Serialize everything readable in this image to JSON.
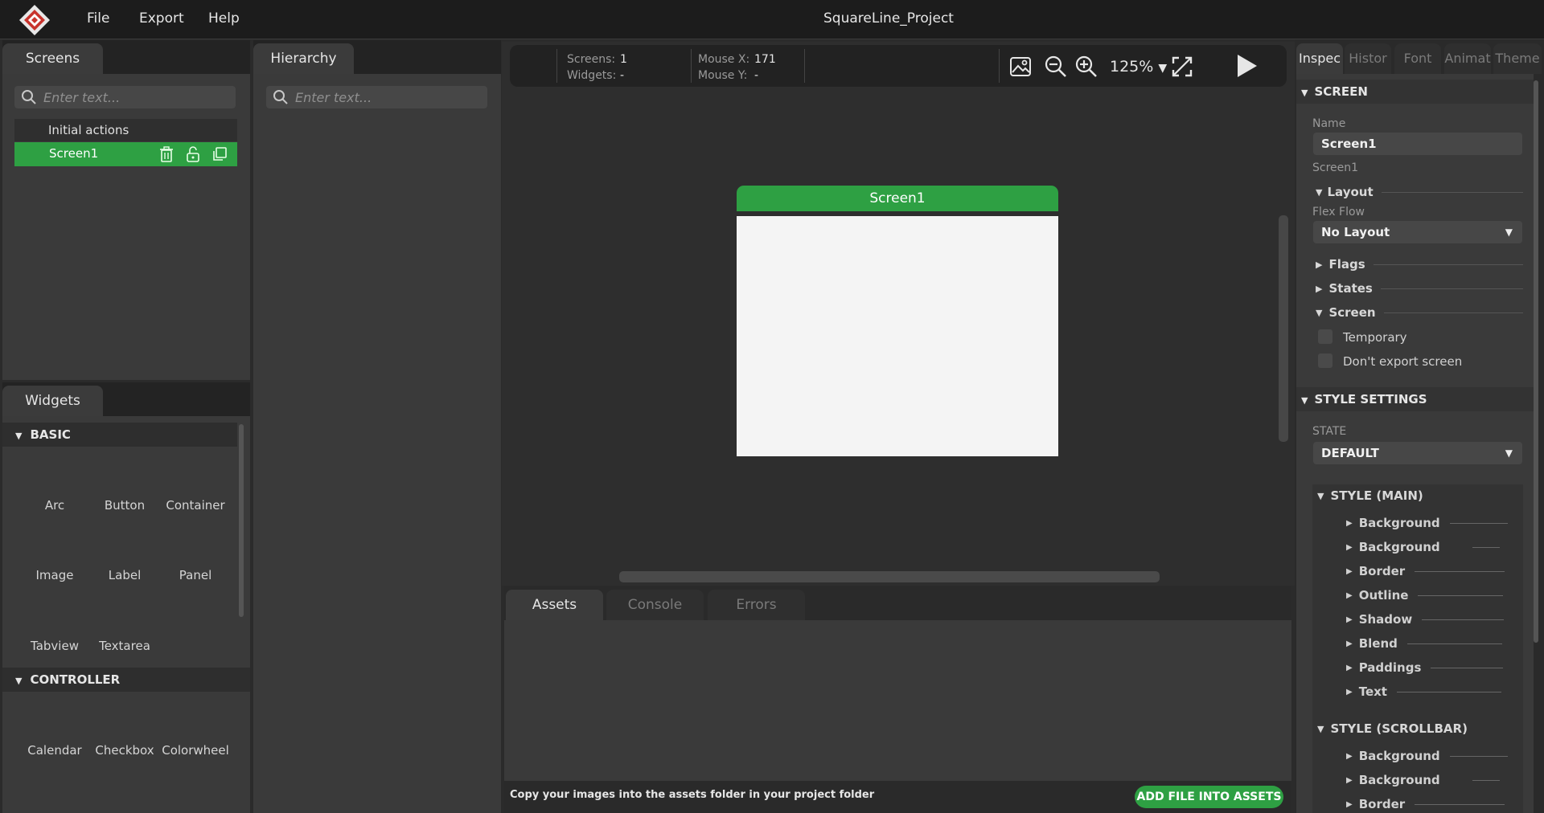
{
  "app": {
    "title": "SquareLine_Project",
    "menu": [
      "File",
      "Export",
      "Help"
    ]
  },
  "screens_panel": {
    "tab": "Screens",
    "search_placeholder": "Enter text...",
    "initial_actions": "Initial actions",
    "screen_item": "Screen1"
  },
  "hierarchy_panel": {
    "tab": "Hierarchy",
    "search_placeholder": "Enter text..."
  },
  "widgets_panel": {
    "tab": "Widgets",
    "basic_header": "BASIC",
    "basic_items": [
      "Arc",
      "Button",
      "Container",
      "Image",
      "Label",
      "Panel",
      "Tabview",
      "Textarea"
    ],
    "controller_header": "CONTROLLER",
    "controller_items": [
      "Calendar",
      "Checkbox",
      "Colorwheel"
    ]
  },
  "toolbar": {
    "screens_label": "Screens:",
    "screens_value": "1",
    "widgets_label": "Widgets:",
    "widgets_value": "-",
    "mouse_x_label": "Mouse X:",
    "mouse_x_value": "171",
    "mouse_y_label": "Mouse Y:",
    "mouse_y_value": "-",
    "zoom": "125%"
  },
  "canvas": {
    "screen_title": "Screen1"
  },
  "bottom_panel": {
    "tabs": [
      "Assets",
      "Console",
      "Errors"
    ],
    "hint": "Copy your images into the assets folder in your project folder",
    "add_button": "ADD FILE INTO ASSETS"
  },
  "inspector": {
    "tabs": [
      "Inspec",
      "Histor",
      "Font",
      "Animat",
      "Theme"
    ],
    "screen_header": "SCREEN",
    "name_label": "Name",
    "name_value": "Screen1",
    "screen_id": "Screen1",
    "layout_header": "Layout",
    "flex_flow_label": "Flex Flow",
    "flex_flow_value": "No Layout",
    "flags_header": "Flags",
    "states_header": "States",
    "screen_sub_header": "Screen",
    "temporary_label": "Temporary",
    "dont_export_label": "Don't export screen",
    "style_settings_header": "STYLE SETTINGS",
    "state_label": "STATE",
    "state_value": "DEFAULT",
    "style_main_header": "STYLE (MAIN)",
    "style_main_items": [
      "Background",
      "Background",
      "Border",
      "Outline",
      "Shadow",
      "Blend",
      "Paddings",
      "Text"
    ],
    "style_scrollbar_header": "STYLE (SCROLLBAR)",
    "style_scrollbar_items": [
      "Background",
      "Background",
      "Border"
    ]
  }
}
